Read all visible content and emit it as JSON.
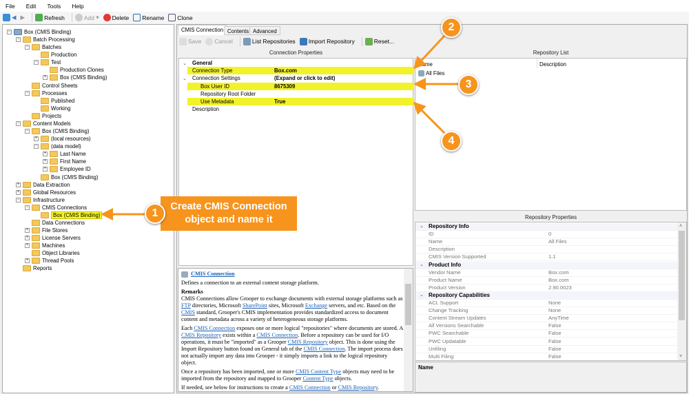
{
  "menu": [
    "File",
    "Edit",
    "Tools",
    "Help"
  ],
  "toolbar": {
    "refresh": "Refresh",
    "add": "Add",
    "delete": "Delete",
    "rename": "Rename",
    "clone": "Clone"
  },
  "tree": [
    {
      "level": 0,
      "label": "Box (CMIS Binding)",
      "exp": "-"
    },
    {
      "level": 1,
      "label": "Batch Processing",
      "exp": "-"
    },
    {
      "level": 2,
      "label": "Batches",
      "exp": "-"
    },
    {
      "level": 3,
      "label": "Production",
      "exp": ""
    },
    {
      "level": 3,
      "label": "Test",
      "exp": "-"
    },
    {
      "level": 4,
      "label": "Production Clones",
      "exp": ""
    },
    {
      "level": 4,
      "label": "Box (CMIS Binding)",
      "exp": "+"
    },
    {
      "level": 2,
      "label": "Control Sheets",
      "exp": ""
    },
    {
      "level": 2,
      "label": "Processes",
      "exp": "-"
    },
    {
      "level": 3,
      "label": "Published",
      "exp": ""
    },
    {
      "level": 3,
      "label": "Working",
      "exp": ""
    },
    {
      "level": 2,
      "label": "Projects",
      "exp": ""
    },
    {
      "level": 1,
      "label": "Content Models",
      "exp": "-"
    },
    {
      "level": 2,
      "label": "Box (CMIS Binding)",
      "exp": "-"
    },
    {
      "level": 3,
      "label": "(local resources)",
      "exp": "+"
    },
    {
      "level": 3,
      "label": "(data model)",
      "exp": "-"
    },
    {
      "level": 4,
      "label": "Last Name",
      "exp": "+"
    },
    {
      "level": 4,
      "label": "First Name",
      "exp": "+"
    },
    {
      "level": 4,
      "label": "Employee ID",
      "exp": "+"
    },
    {
      "level": 3,
      "label": "Box (CMIS Binding)",
      "exp": ""
    },
    {
      "level": 1,
      "label": "Data Extraction",
      "exp": "+"
    },
    {
      "level": 1,
      "label": "Global Resources",
      "exp": "+"
    },
    {
      "level": 1,
      "label": "Infrastructure",
      "exp": "-"
    },
    {
      "level": 2,
      "label": "CMIS Connections",
      "exp": "-"
    },
    {
      "level": 3,
      "label": "Box (CMIS Binding)",
      "exp": "",
      "selected": true
    },
    {
      "level": 2,
      "label": "Data Connections",
      "exp": ""
    },
    {
      "level": 2,
      "label": "File Stores",
      "exp": "+"
    },
    {
      "level": 2,
      "label": "License Servers",
      "exp": "+"
    },
    {
      "level": 2,
      "label": "Machines",
      "exp": "+"
    },
    {
      "level": 2,
      "label": "Object Libraries",
      "exp": ""
    },
    {
      "level": 2,
      "label": "Thread Pools",
      "exp": "+"
    },
    {
      "level": 1,
      "label": "Reports",
      "exp": ""
    }
  ],
  "tabs": [
    "CMIS Connection",
    "Contents",
    "Advanced"
  ],
  "subtoolbar": {
    "save": "Save",
    "cancel": "Cancel",
    "list": "List Repositories",
    "import": "Import Repository",
    "reset": "Reset..."
  },
  "connection_properties": {
    "title": "Connection Properties",
    "rows": [
      {
        "type": "cat",
        "key": "General",
        "value": ""
      },
      {
        "type": "hl",
        "key": "Connection Type",
        "value": "Box.com"
      },
      {
        "type": "cat2",
        "key": "Connection Settings",
        "value": "(Expand or click to edit)"
      },
      {
        "type": "hl2",
        "key": "Box User ID",
        "value": "8675309"
      },
      {
        "type": "sub",
        "key": "Repository Root Folder",
        "value": ""
      },
      {
        "type": "hl2",
        "key": "Use Metadata",
        "value": "True"
      },
      {
        "type": "plain",
        "key": "Description",
        "value": ""
      }
    ]
  },
  "repository_list": {
    "title": "Repository List",
    "columns": [
      "Name",
      "Description"
    ],
    "items": [
      "All Files"
    ]
  },
  "repository_properties": {
    "title": "Repository Properties",
    "rows": [
      {
        "cat": true,
        "key": "Repository Info"
      },
      {
        "key": "ID",
        "value": "0"
      },
      {
        "key": "Name",
        "value": "All Files"
      },
      {
        "key": "Description",
        "value": ""
      },
      {
        "key": "CMIS Version Supported",
        "value": "1.1"
      },
      {
        "cat": true,
        "key": "Product Info"
      },
      {
        "key": "Vendor Name",
        "value": "Box.com"
      },
      {
        "key": "Product Name",
        "value": "Box.com"
      },
      {
        "key": "Product Version",
        "value": "2.90.0023"
      },
      {
        "cat": true,
        "key": "Repository Capabilities"
      },
      {
        "key": "ACL Support",
        "value": "None"
      },
      {
        "key": "Change Tracking",
        "value": "None"
      },
      {
        "key": "Content Stream Updates",
        "value": "AnyTime"
      },
      {
        "key": "All Versions Searchable",
        "value": "False"
      },
      {
        "key": "PWC Searchable",
        "value": "False"
      },
      {
        "key": "PWC Updatable",
        "value": "False"
      },
      {
        "key": "Unfiling",
        "value": "False"
      },
      {
        "key": "Multi Filing",
        "value": "False"
      }
    ],
    "description_label": "Name"
  },
  "help": {
    "title": "CMIS Connection",
    "summary": "Defines a connection to an external content storage platform.",
    "remarks_label": "Remarks",
    "paragraphs": [
      [
        {
          "t": "CMIS Connections allow Grooper to exchange documents with external storage platforms such as "
        },
        {
          "t": "FTP",
          "l": 1
        },
        {
          "t": " directories, Microsoft "
        },
        {
          "t": "SharePoint",
          "l": 1
        },
        {
          "t": " sites, Microsoft "
        },
        {
          "t": "Exchange",
          "l": 1
        },
        {
          "t": " servers, and etc. Based on the "
        },
        {
          "t": "CMIS",
          "l": 1
        },
        {
          "t": " standard, Grooper's CMIS implementation provides standardized access to document content and metadata across a variety of heterogeneous storage platforms."
        }
      ],
      [
        {
          "t": "Each "
        },
        {
          "t": "CMIS Connection",
          "l": 1
        },
        {
          "t": " exposes one or more logical \"repositories\" where documents are stored. A "
        },
        {
          "t": "CMIS Repository",
          "l": 1
        },
        {
          "t": " exists within a "
        },
        {
          "t": "CMIS Connection",
          "l": 1
        },
        {
          "t": ". Before a repository can be used for I/O operations, it must be \"imported\" as a Grooper "
        },
        {
          "t": "CMIS Repository",
          "l": 1
        },
        {
          "t": " object. This is done using the Import Repository button found on General tab of the "
        },
        {
          "t": "CMIS Connection",
          "l": 1
        },
        {
          "t": ". The import process does not actually import any data into Grooper - it simply imports a link to the logical repository object."
        }
      ],
      [
        {
          "t": "Once a repository has been imported, one or more "
        },
        {
          "t": "CMIS Content Type",
          "l": 1
        },
        {
          "t": " objects may need to be imported from the repository and mapped to Grooper "
        },
        {
          "t": "Content Type",
          "l": 1
        },
        {
          "t": " objects."
        }
      ],
      [
        {
          "t": "If needed, see below for instructions to create a "
        },
        {
          "t": "CMIS Connection",
          "l": 1
        },
        {
          "t": " or "
        },
        {
          "t": "CMIS Repository",
          "l": 1
        },
        {
          "t": "."
        }
      ]
    ]
  },
  "callouts": {
    "c1": "1",
    "c1_text": "Create CMIS Connection object and name it",
    "c2": "2",
    "c3": "3",
    "c4": "4"
  },
  "colors": {
    "accent": "#f7941d",
    "highlight": "#f2f22a"
  }
}
